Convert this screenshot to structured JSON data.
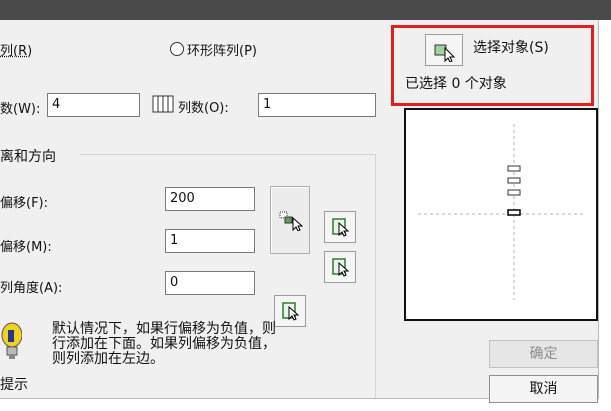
{
  "array_type": {
    "rect_label": "列(R)",
    "polar_label": "环形阵列(P)"
  },
  "rows": {
    "label": "数(W):",
    "value": "4"
  },
  "columns": {
    "label": "列数(O):",
    "value": "1"
  },
  "offset_section": {
    "title": "离和方向"
  },
  "row_offset": {
    "label": "偏移(F):",
    "value": "200"
  },
  "col_offset": {
    "label": "偏移(M):",
    "value": "1"
  },
  "array_angle": {
    "label": "列角度(A):",
    "value": "0"
  },
  "tip": {
    "lines": [
      "默认情况下，如果行偏移为负值，则",
      "行添加在下面。如果列偏移为负值，",
      "则列添加在左边。"
    ],
    "label": "提示"
  },
  "select_objects": {
    "label": "选择对象(S)",
    "status": "已选择 0 个对象"
  },
  "buttons": {
    "ok": "确定",
    "cancel": "取消"
  },
  "icons": {
    "pick": "pick-point-icon",
    "pick_both": "pick-both-offsets-icon",
    "columns": "columns-icon",
    "tip": "lightbulb-icon",
    "select": "select-objects-icon"
  },
  "colors": {
    "highlight": "#e0201e",
    "titlebar": "#4a4a4a",
    "dialog_bg": "#f0f0f0"
  }
}
